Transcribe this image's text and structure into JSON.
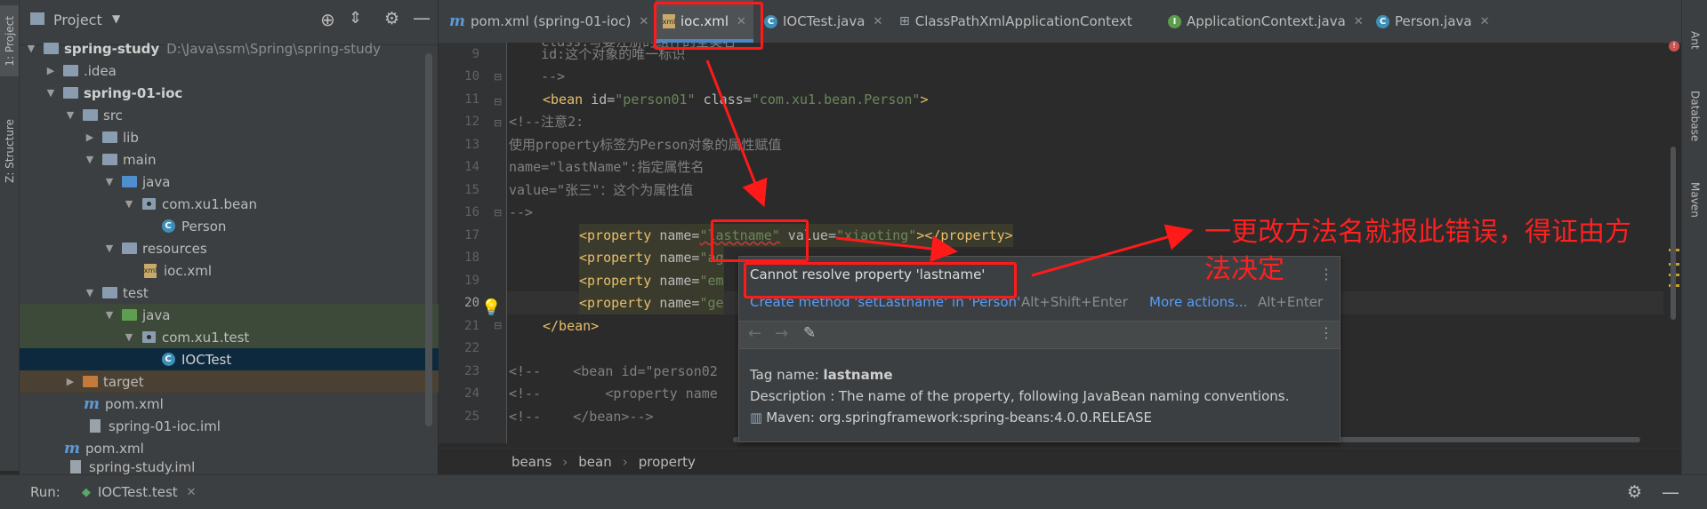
{
  "left_strip": {
    "project_tab": "1: Project",
    "structure_tab": "Z: Structure"
  },
  "right_strip": {
    "ant_tab": "Ant",
    "database_tab": "Database",
    "maven_tab": "Maven"
  },
  "project_panel": {
    "title": "Project",
    "tree": [
      {
        "label": "spring-study",
        "extra": "D:\\Java\\ssm\\Spring\\spring-study",
        "bold": true
      },
      {
        "label": ".idea"
      },
      {
        "label": "spring-01-ioc",
        "bold": true
      },
      {
        "label": "src"
      },
      {
        "label": "lib"
      },
      {
        "label": "main"
      },
      {
        "label": "java"
      },
      {
        "label": "com.xu1.bean"
      },
      {
        "label": "Person"
      },
      {
        "label": "resources"
      },
      {
        "label": "ioc.xml"
      },
      {
        "label": "test"
      },
      {
        "label": "java"
      },
      {
        "label": "com.xu1.test"
      },
      {
        "label": "IOCTest"
      },
      {
        "label": "target"
      },
      {
        "label": "pom.xml"
      },
      {
        "label": "spring-01-ioc.iml"
      },
      {
        "label": "pom.xml"
      },
      {
        "label": "spring-study.iml"
      }
    ]
  },
  "tabs": [
    {
      "label": "pom.xml (spring-01-ioc)",
      "icon": "maven-icon"
    },
    {
      "label": "ioc.xml",
      "icon": "xml-icon",
      "active": true
    },
    {
      "label": "IOCTest.java",
      "icon": "class-icon"
    },
    {
      "label": "ClassPathXmlApplicationContext",
      "icon": "hierarchy-icon"
    },
    {
      "label": "ApplicationContext.java",
      "icon": "interface-icon"
    },
    {
      "label": "Person.java",
      "icon": "class-icon"
    }
  ],
  "editor": {
    "line_numbers": [
      "9",
      "10",
      "11",
      "12",
      "13",
      "14",
      "15",
      "16",
      "17",
      "18",
      "19",
      "20",
      "21",
      "22",
      "23",
      "24",
      "25"
    ],
    "lines": {
      "l8": "    class:写要注册的组件的全类名",
      "l9": "    id:这个对象的唯一标识",
      "l10": "    -->",
      "l11_tag": "<bean ",
      "l11_a1": "id=",
      "l11_v1": "\"person01\" ",
      "l11_a2": "class=",
      "l11_v2": "\"com.xu1.bean.Person\"",
      "l11_end": ">",
      "l12": "<!--注意2:",
      "l13": "使用property标签为Person对象的属性赋值",
      "l14": "name=\"lastName\":指定属性名",
      "l15": "value=\"张三\"：这个为属性值",
      "l16": "-->",
      "l17_tag": "<property ",
      "l17_a1": "name=",
      "l17_v1": "\"lastname\"",
      "l17_a2": " value=",
      "l17_v2": "\"xiaoting\"",
      "l17_end": "></property>",
      "l18_tag": "<property ",
      "l18_a": "name=",
      "l18_v": "\"ag",
      "l19_tag": "<property ",
      "l19_a": "name=",
      "l19_v": "\"em",
      "l20_tag": "<property ",
      "l20_a": "name=",
      "l20_v": "\"ge",
      "l21": "</bean>",
      "l23": "<!--    <bean id=\"person02",
      "l24": "<!--        <property name",
      "l25": "<!--    </bean>-->"
    }
  },
  "popup": {
    "error": "Cannot resolve property 'lastname'",
    "fix_action": "Create method 'setLastname' in 'Person'",
    "fix_shortcut": "Alt+Shift+Enter",
    "more_actions": "More actions...",
    "more_shortcut": "Alt+Enter",
    "tag_name_label": "Tag name: ",
    "tag_name": "lastname",
    "description": "Description : The name of the property, following JavaBean naming conventions.",
    "maven": "Maven: org.springframework:spring-beans:4.0.0.RELEASE"
  },
  "breadcrumb": [
    "beans",
    "bean",
    "property"
  ],
  "run_bar": {
    "label": "Run:",
    "config": "IOCTest.test"
  },
  "annotation": {
    "line1": "一更改方法名就报此错误，得证由方",
    "line2": "法决定"
  },
  "colors": {
    "annotation_red": "#ff1a1a",
    "active_tab_underline": "#4a88c7"
  }
}
